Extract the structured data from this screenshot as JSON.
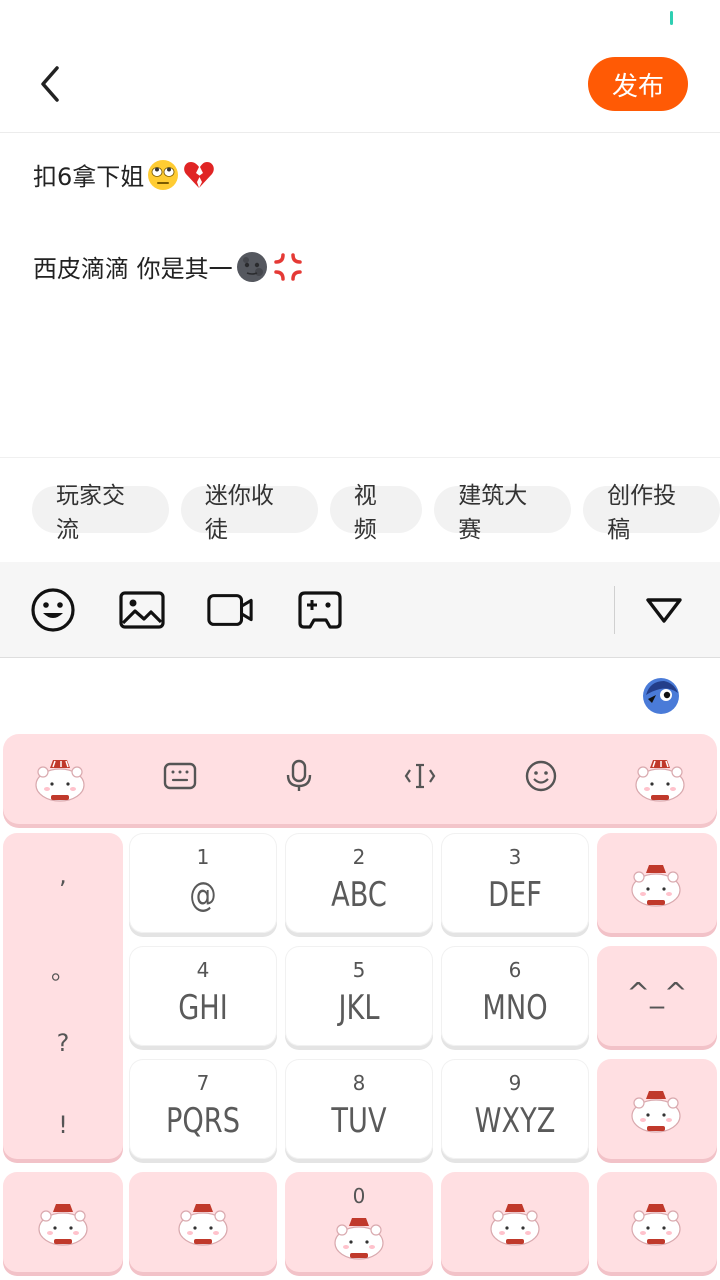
{
  "header": {
    "back_icon": "chevron-left-icon",
    "publish_label": "发布"
  },
  "editor": {
    "line1_text": "扣6拿下姐",
    "line1_emojis": [
      "face-with-rolling-eyes-emoji",
      "broken-heart-emoji"
    ],
    "line2_text": "西皮滴滴 你是其一",
    "line2_emojis": [
      "new-moon-face-emoji",
      "anger-symbol-emoji"
    ]
  },
  "topics": [
    "玩家交流",
    "迷你收徒",
    "视频",
    "建筑大赛",
    "创作投稿"
  ],
  "toolbar": {
    "icons": [
      "emoji-icon",
      "image-icon",
      "video-icon",
      "gamepad-icon",
      "collapse-icon"
    ]
  },
  "ime": {
    "logo_icon": "ime-logo-icon",
    "top_bar_icons": [
      "bear-sticker",
      "keyboard-icon",
      "microphone-icon",
      "cursor-icon",
      "emoji-icon",
      "bear-sticker"
    ]
  },
  "keypad": {
    "punct": [
      ",",
      "。",
      "?",
      "!"
    ],
    "keys": [
      {
        "num": "1",
        "letters": "@"
      },
      {
        "num": "2",
        "letters": "ABC"
      },
      {
        "num": "3",
        "letters": "DEF"
      },
      {
        "num": "4",
        "letters": "GHI"
      },
      {
        "num": "5",
        "letters": "JKL"
      },
      {
        "num": "6",
        "letters": "MNO"
      },
      {
        "num": "7",
        "letters": "PQRS"
      },
      {
        "num": "8",
        "letters": "TUV"
      },
      {
        "num": "9",
        "letters": "WXYZ"
      }
    ],
    "face_key": "^_^",
    "zero_num": "0"
  },
  "colors": {
    "accent": "#ff5a05",
    "key_pink": "#ffdfe2",
    "status_dot": "#2ecfb2"
  }
}
